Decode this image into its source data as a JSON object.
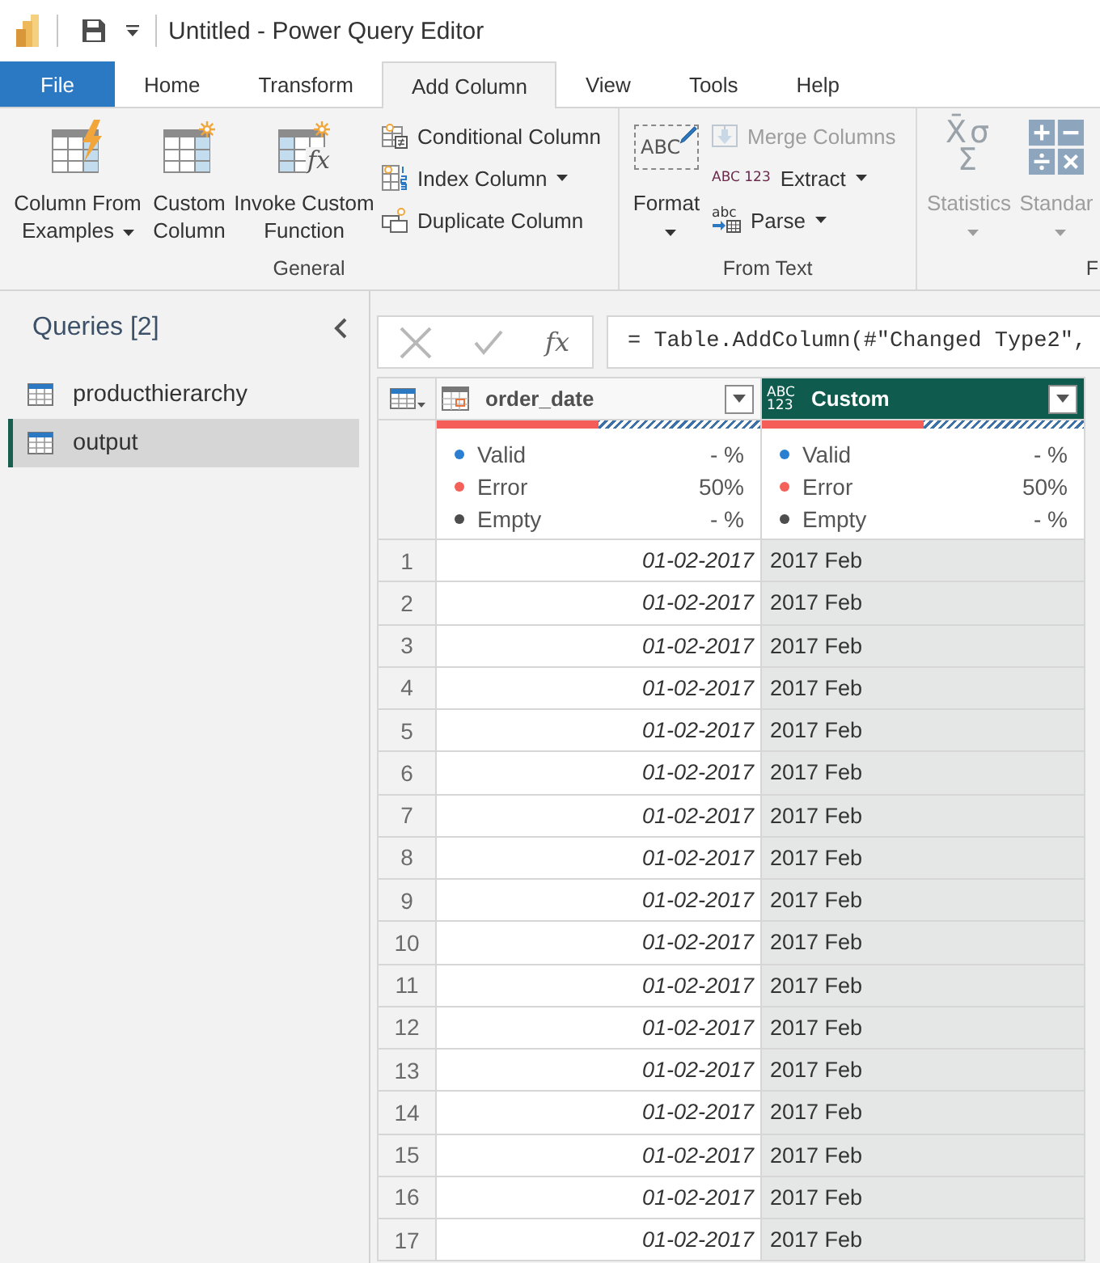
{
  "title_bar": {
    "title": "Untitled - Power Query Editor"
  },
  "tabs": [
    {
      "label": "File",
      "kind": "file",
      "selected": false
    },
    {
      "label": "Home",
      "kind": "tab",
      "selected": false
    },
    {
      "label": "Transform",
      "kind": "tab",
      "selected": false
    },
    {
      "label": "Add Column",
      "kind": "tab",
      "selected": true
    },
    {
      "label": "View",
      "kind": "tab",
      "selected": false
    },
    {
      "label": "Tools",
      "kind": "tab",
      "selected": false
    },
    {
      "label": "Help",
      "kind": "tab",
      "selected": false
    }
  ],
  "ribbon": {
    "groups": [
      {
        "label": "General",
        "items": [
          {
            "kind": "large",
            "label": "Column From Examples",
            "dropdown": true,
            "disabled": false
          },
          {
            "kind": "large",
            "label": "Custom Column",
            "dropdown": false,
            "disabled": false
          },
          {
            "kind": "large",
            "label": "Invoke Custom Function",
            "icon_text": "fx",
            "dropdown": false,
            "disabled": false
          },
          {
            "kind": "small",
            "label": "Conditional Column",
            "dropdown": false,
            "disabled": false
          },
          {
            "kind": "small",
            "label": "Index Column",
            "dropdown": true,
            "disabled": false
          },
          {
            "kind": "small",
            "label": "Duplicate Column",
            "dropdown": false,
            "disabled": false
          }
        ]
      },
      {
        "label": "From Text",
        "items": [
          {
            "kind": "large",
            "label": "Format",
            "icon_text": "ABC",
            "dropdown": true,
            "disabled": false
          },
          {
            "kind": "small",
            "label": "Merge Columns",
            "dropdown": false,
            "disabled": true
          },
          {
            "kind": "small",
            "label": "Extract",
            "icon_text": "ABC 123",
            "dropdown": true,
            "disabled": false
          },
          {
            "kind": "small",
            "label": "Parse",
            "icon_text": "abc",
            "dropdown": true,
            "disabled": false
          }
        ]
      },
      {
        "label": "F",
        "items": [
          {
            "kind": "large",
            "label": "Statistics",
            "icon_text": "X̄σ Σ",
            "dropdown": true,
            "disabled": true
          },
          {
            "kind": "large",
            "label": "Standar",
            "dropdown": true,
            "disabled": true
          }
        ]
      }
    ]
  },
  "queries": {
    "title": "Queries [2]",
    "items": [
      {
        "label": "producthierarchy",
        "selected": false
      },
      {
        "label": "output",
        "selected": true
      }
    ]
  },
  "formula_bar": {
    "fx_label": "fx",
    "formula": "= Table.AddColumn(#\"Changed Type2\","
  },
  "grid": {
    "columns": [
      {
        "name": "order_date",
        "kind": "date",
        "selected": false,
        "quality_bar": {
          "level": 0.5
        },
        "stats": [
          {
            "label": "Valid",
            "value": "- %",
            "color": "#2a7fd0"
          },
          {
            "label": "Error",
            "value": "50%",
            "color": "#f4605a"
          },
          {
            "label": "Empty",
            "value": "- %",
            "color": "#4d4d4d"
          }
        ]
      },
      {
        "name": "Custom",
        "kind": "any",
        "type_label": "ABC 123",
        "selected": true,
        "quality_bar": {
          "level": 0.5
        },
        "stats": [
          {
            "label": "Valid",
            "value": "- %",
            "color": "#2a7fd0"
          },
          {
            "label": "Error",
            "value": "50%",
            "color": "#f4605a"
          },
          {
            "label": "Empty",
            "value": "- %",
            "color": "#4d4d4d"
          }
        ]
      }
    ],
    "rows": [
      {
        "number": "1",
        "cells": [
          "01-02-2017",
          "2017 Feb"
        ]
      },
      {
        "number": "2",
        "cells": [
          "01-02-2017",
          "2017 Feb"
        ]
      },
      {
        "number": "3",
        "cells": [
          "01-02-2017",
          "2017 Feb"
        ]
      },
      {
        "number": "4",
        "cells": [
          "01-02-2017",
          "2017 Feb"
        ]
      },
      {
        "number": "5",
        "cells": [
          "01-02-2017",
          "2017 Feb"
        ]
      },
      {
        "number": "6",
        "cells": [
          "01-02-2017",
          "2017 Feb"
        ]
      },
      {
        "number": "7",
        "cells": [
          "01-02-2017",
          "2017 Feb"
        ]
      },
      {
        "number": "8",
        "cells": [
          "01-02-2017",
          "2017 Feb"
        ]
      },
      {
        "number": "9",
        "cells": [
          "01-02-2017",
          "2017 Feb"
        ]
      },
      {
        "number": "10",
        "cells": [
          "01-02-2017",
          "2017 Feb"
        ]
      },
      {
        "number": "11",
        "cells": [
          "01-02-2017",
          "2017 Feb"
        ]
      },
      {
        "number": "12",
        "cells": [
          "01-02-2017",
          "2017 Feb"
        ]
      },
      {
        "number": "13",
        "cells": [
          "01-02-2017",
          "2017 Feb"
        ]
      },
      {
        "number": "14",
        "cells": [
          "01-02-2017",
          "2017 Feb"
        ]
      },
      {
        "number": "15",
        "cells": [
          "01-02-2017",
          "2017 Feb"
        ]
      },
      {
        "number": "16",
        "cells": [
          "01-02-2017",
          "2017 Feb"
        ]
      },
      {
        "number": "17",
        "cells": [
          "01-02-2017",
          "2017 Feb"
        ]
      }
    ]
  }
}
